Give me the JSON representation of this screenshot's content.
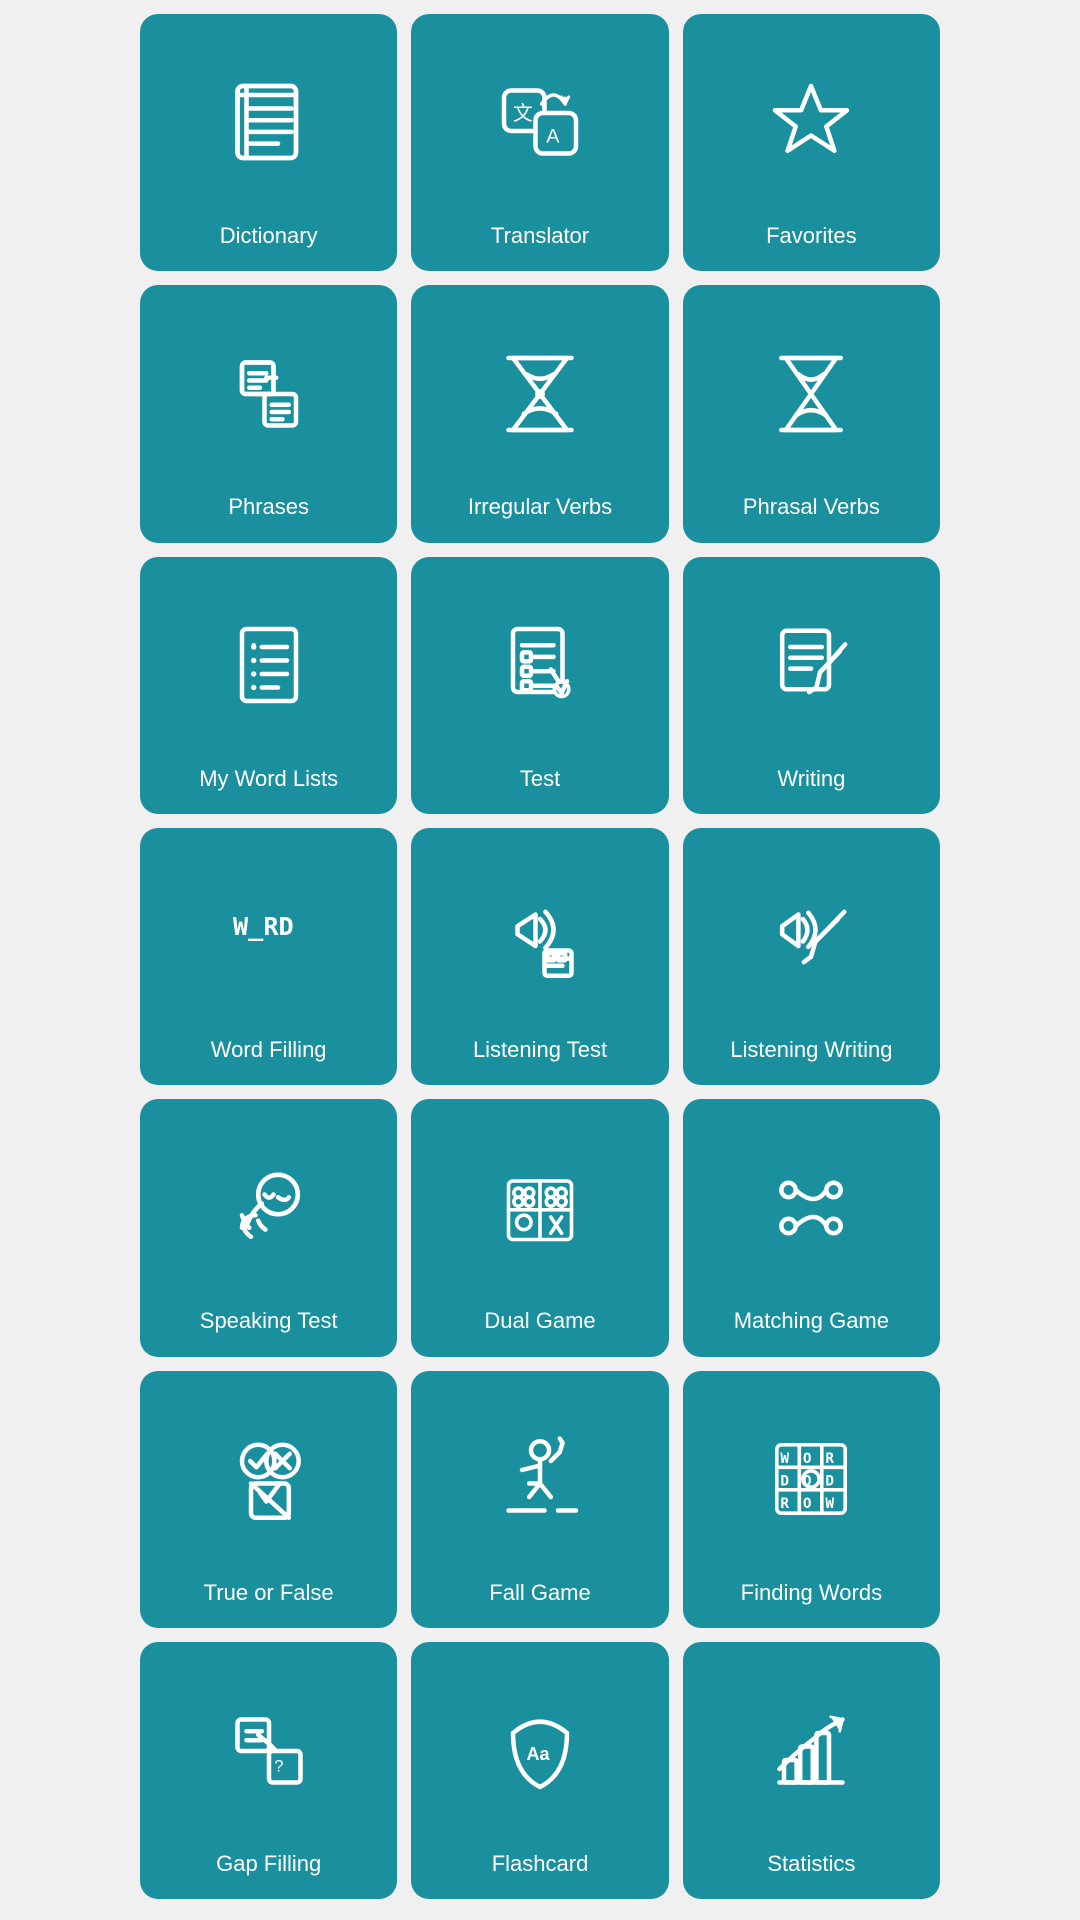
{
  "cards": [
    {
      "id": "dictionary",
      "label": "Dictionary",
      "icon": "dictionary"
    },
    {
      "id": "translator",
      "label": "Translator",
      "icon": "translator"
    },
    {
      "id": "favorites",
      "label": "Favorites",
      "icon": "favorites"
    },
    {
      "id": "phrases",
      "label": "Phrases",
      "icon": "phrases"
    },
    {
      "id": "irregular-verbs",
      "label": "Irregular Verbs",
      "icon": "hourglass"
    },
    {
      "id": "phrasal-verbs",
      "label": "Phrasal Verbs",
      "icon": "hourglass2"
    },
    {
      "id": "my-word-lists",
      "label": "My Word Lists",
      "icon": "wordlists"
    },
    {
      "id": "test",
      "label": "Test",
      "icon": "test"
    },
    {
      "id": "writing",
      "label": "Writing",
      "icon": "writing"
    },
    {
      "id": "word-filling",
      "label": "Word Filling",
      "icon": "wordfilling"
    },
    {
      "id": "listening-test",
      "label": "Listening Test",
      "icon": "listeningtest"
    },
    {
      "id": "listening-writing",
      "label": "Listening Writing",
      "icon": "listeningwriting"
    },
    {
      "id": "speaking-test",
      "label": "Speaking Test",
      "icon": "speakingtest"
    },
    {
      "id": "dual-game",
      "label": "Dual Game",
      "icon": "dualgame"
    },
    {
      "id": "matching-game",
      "label": "Matching Game",
      "icon": "matchinggame"
    },
    {
      "id": "true-or-false",
      "label": "True or False",
      "icon": "trueorfalse"
    },
    {
      "id": "fall-game",
      "label": "Fall Game",
      "icon": "fallgame"
    },
    {
      "id": "finding-words",
      "label": "Finding Words",
      "icon": "findingwords"
    },
    {
      "id": "gap-filling",
      "label": "Gap Filling",
      "icon": "gapfilling"
    },
    {
      "id": "flashcard",
      "label": "Flashcard",
      "icon": "flashcard"
    },
    {
      "id": "statistics",
      "label": "Statistics",
      "icon": "statistics"
    }
  ]
}
